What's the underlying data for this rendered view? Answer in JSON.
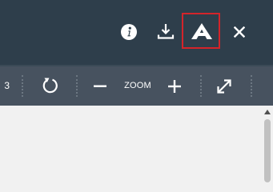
{
  "toolbar": {
    "page_number": "3",
    "zoom_label": "ZOOM"
  },
  "icons": {
    "info": "info-icon",
    "download": "download-icon",
    "font": "font-icon",
    "close": "close-icon",
    "rotate": "rotate-icon",
    "zoom_out": "minus-icon",
    "zoom_in": "plus-icon",
    "fullscreen": "expand-icon"
  },
  "colors": {
    "topbar": "#2e3e4b",
    "toolbar": "#47525f",
    "highlight": "#d4242a",
    "icon": "#ffffff"
  }
}
